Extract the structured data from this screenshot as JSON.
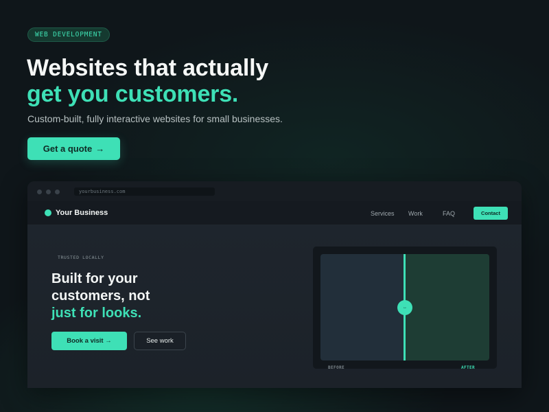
{
  "hero": {
    "tag": "WEB DEVELOPMENT",
    "headline_line1": "Websites that actually",
    "headline_line2": "get you customers.",
    "subheadline": "Custom-built, fully interactive websites for small businesses.",
    "cta_label": "Get a quote",
    "cta_arrow": "→"
  },
  "browser": {
    "url": "yourbusiness.com"
  },
  "site": {
    "brand": "Your Business",
    "nav": [
      "Services",
      "Work",
      "FAQ"
    ],
    "contact_label": "Contact",
    "badge": "TRUSTED LOCALLY",
    "headline_line1": "Built for your",
    "headline_line2": "customers, not",
    "headline_line3": "just for looks.",
    "primary_button": "Book a visit →",
    "secondary_button": "See work",
    "compare": {
      "handle_glyph": "↔",
      "before_label": "BEFORE",
      "after_label": "AFTER"
    }
  },
  "colors": {
    "accent": "#3ee0b6",
    "background": "#0f161a",
    "text": "#f2f5f4"
  },
  "icons": {
    "compare_handle": "arrows-horizontal-icon",
    "brand_mark": "dot-logo-icon"
  }
}
